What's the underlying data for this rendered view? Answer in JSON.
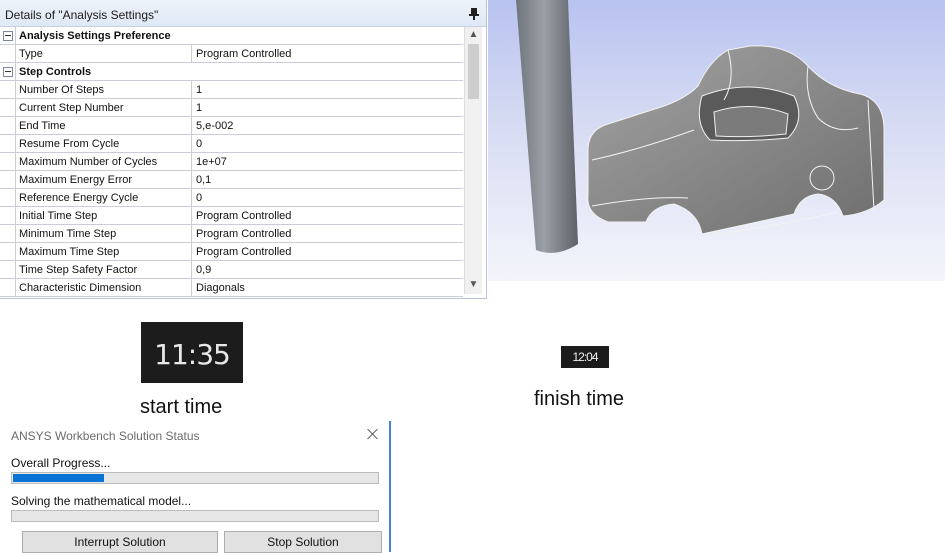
{
  "details_panel": {
    "title": "Details of \"Analysis Settings\"",
    "icons": {
      "pin": "pin-icon",
      "scroll_up": "chevron-up-icon",
      "scroll_down": "chevron-down-icon"
    },
    "groups": [
      {
        "label": "Analysis Settings Preference",
        "rows": [
          {
            "name": "Type",
            "value": "Program Controlled"
          }
        ]
      },
      {
        "label": "Step Controls",
        "rows": [
          {
            "name": "Number Of Steps",
            "value": "1"
          },
          {
            "name": "Current Step Number",
            "value": "1"
          },
          {
            "name": "End Time",
            "value": "5,e-002"
          },
          {
            "name": "Resume From Cycle",
            "value": "0"
          },
          {
            "name": "Maximum Number of Cycles",
            "value": "1e+07"
          },
          {
            "name": "Maximum Energy Error",
            "value": "0,1"
          },
          {
            "name": "Reference Energy Cycle",
            "value": "0"
          },
          {
            "name": "Initial Time Step",
            "value": "Program Controlled"
          },
          {
            "name": "Minimum Time Step",
            "value": "Program Controlled"
          },
          {
            "name": "Maximum Time Step",
            "value": "Program Controlled"
          },
          {
            "name": "Time Step Safety Factor",
            "value": "0,9"
          },
          {
            "name": "Characteristic Dimension",
            "value": "Diagonals"
          }
        ]
      }
    ]
  },
  "viewport": {
    "background_top": "#b9c3f0",
    "background_bottom": "#f4f5fb",
    "model_color": "#8c8c8c"
  },
  "start_clock": {
    "time": "11:35",
    "caption": "start time"
  },
  "finish_clock": {
    "time": "12:04",
    "caption": "finish time"
  },
  "solution_dialog": {
    "title": "ANSYS Workbench Solution Status",
    "overall_label": "Overall Progress...",
    "overall_progress": 0.25,
    "solve_label": "Solving the mathematical model...",
    "solve_progress": 0,
    "interrupt_button": "Interrupt Solution",
    "stop_button": "Stop Solution",
    "accent_color": "#0a74d6"
  }
}
